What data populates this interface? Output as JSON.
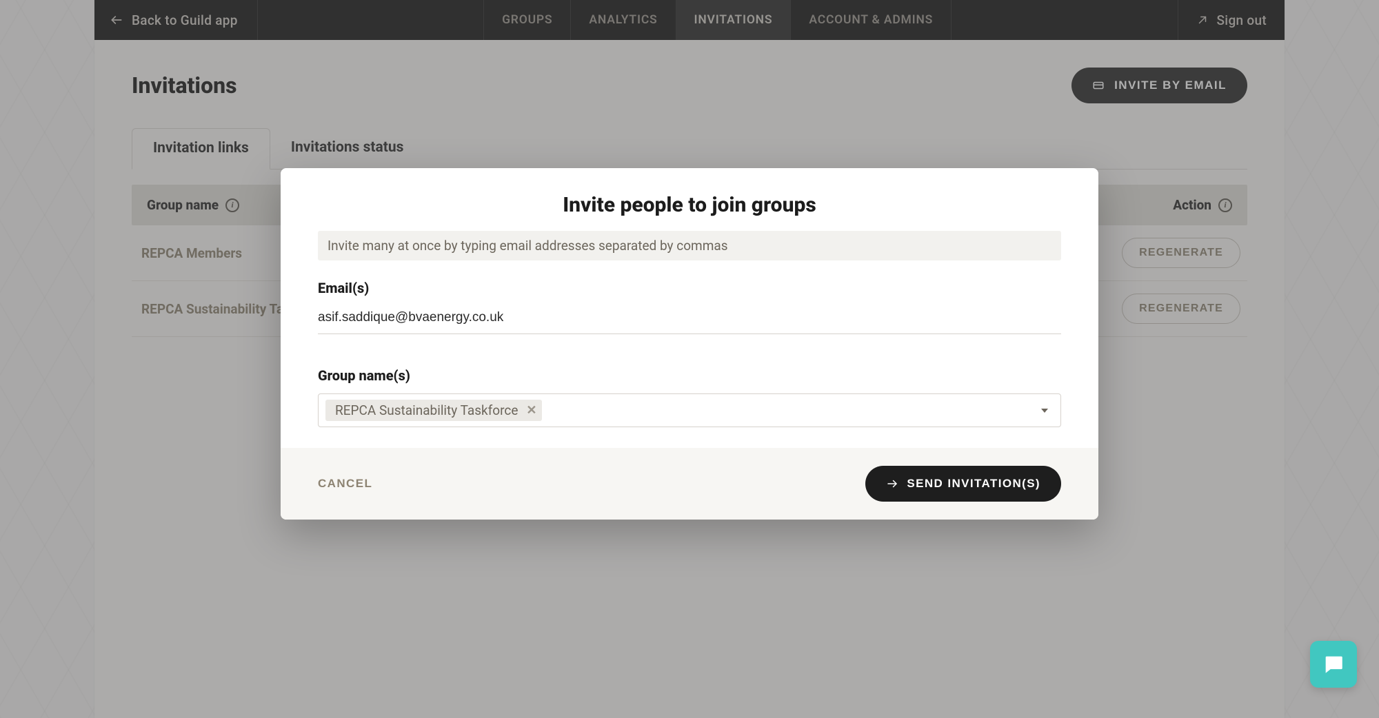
{
  "topbar": {
    "back_label": "Back to Guild app",
    "nav": {
      "groups": "Groups",
      "analytics": "Analytics",
      "invitations": "Invitations",
      "account": "Account & Admins"
    },
    "signout": "Sign out"
  },
  "page": {
    "title": "Invitations",
    "invite_button": "Invite by email",
    "tabs": {
      "links": "Invitation links",
      "status": "Invitations status"
    },
    "columns": {
      "group_name": "Group name",
      "action": "Action"
    },
    "rows": [
      {
        "name": "REPCA Members",
        "action": "Regenerate"
      },
      {
        "name": "REPCA Sustainability Taskforce",
        "action": "Regenerate"
      }
    ]
  },
  "modal": {
    "title": "Invite people to join groups",
    "hint": "Invite many at once by typing email addresses separated by commas",
    "emails_label": "Email(s)",
    "emails_value": "asif.saddique@bvaenergy.co.uk",
    "groups_label": "Group name(s)",
    "selected_group": "REPCA Sustainability Taskforce",
    "cancel": "Cancel",
    "send": "Send invitation(s)"
  }
}
